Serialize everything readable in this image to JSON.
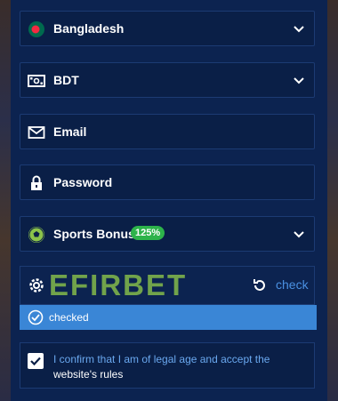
{
  "country": {
    "label": "Bangladesh",
    "icon": "bangladesh-flag-icon"
  },
  "currency": {
    "label": "BDT",
    "icon": "cash-icon"
  },
  "email": {
    "placeholder": "Email",
    "icon": "envelope-icon"
  },
  "password": {
    "placeholder": "Password",
    "icon": "lock-icon"
  },
  "bonus": {
    "label": "Sports Bonus",
    "badge": "125%",
    "icon": "soccer-ball-icon"
  },
  "captcha": {
    "brand": "EFIRBET",
    "check_label": "check",
    "icon": "gear-icon"
  },
  "status": {
    "text": "checked"
  },
  "terms": {
    "text": "I confirm that I am of legal age and accept the",
    "link": "website's rules",
    "checked": true
  },
  "colors": {
    "background": "#0c2350",
    "accent": "#3a86d6",
    "badge": "#2db34a",
    "link": "#6aa8ef",
    "flag_green": "#006a4e",
    "flag_red": "#f42a41"
  }
}
